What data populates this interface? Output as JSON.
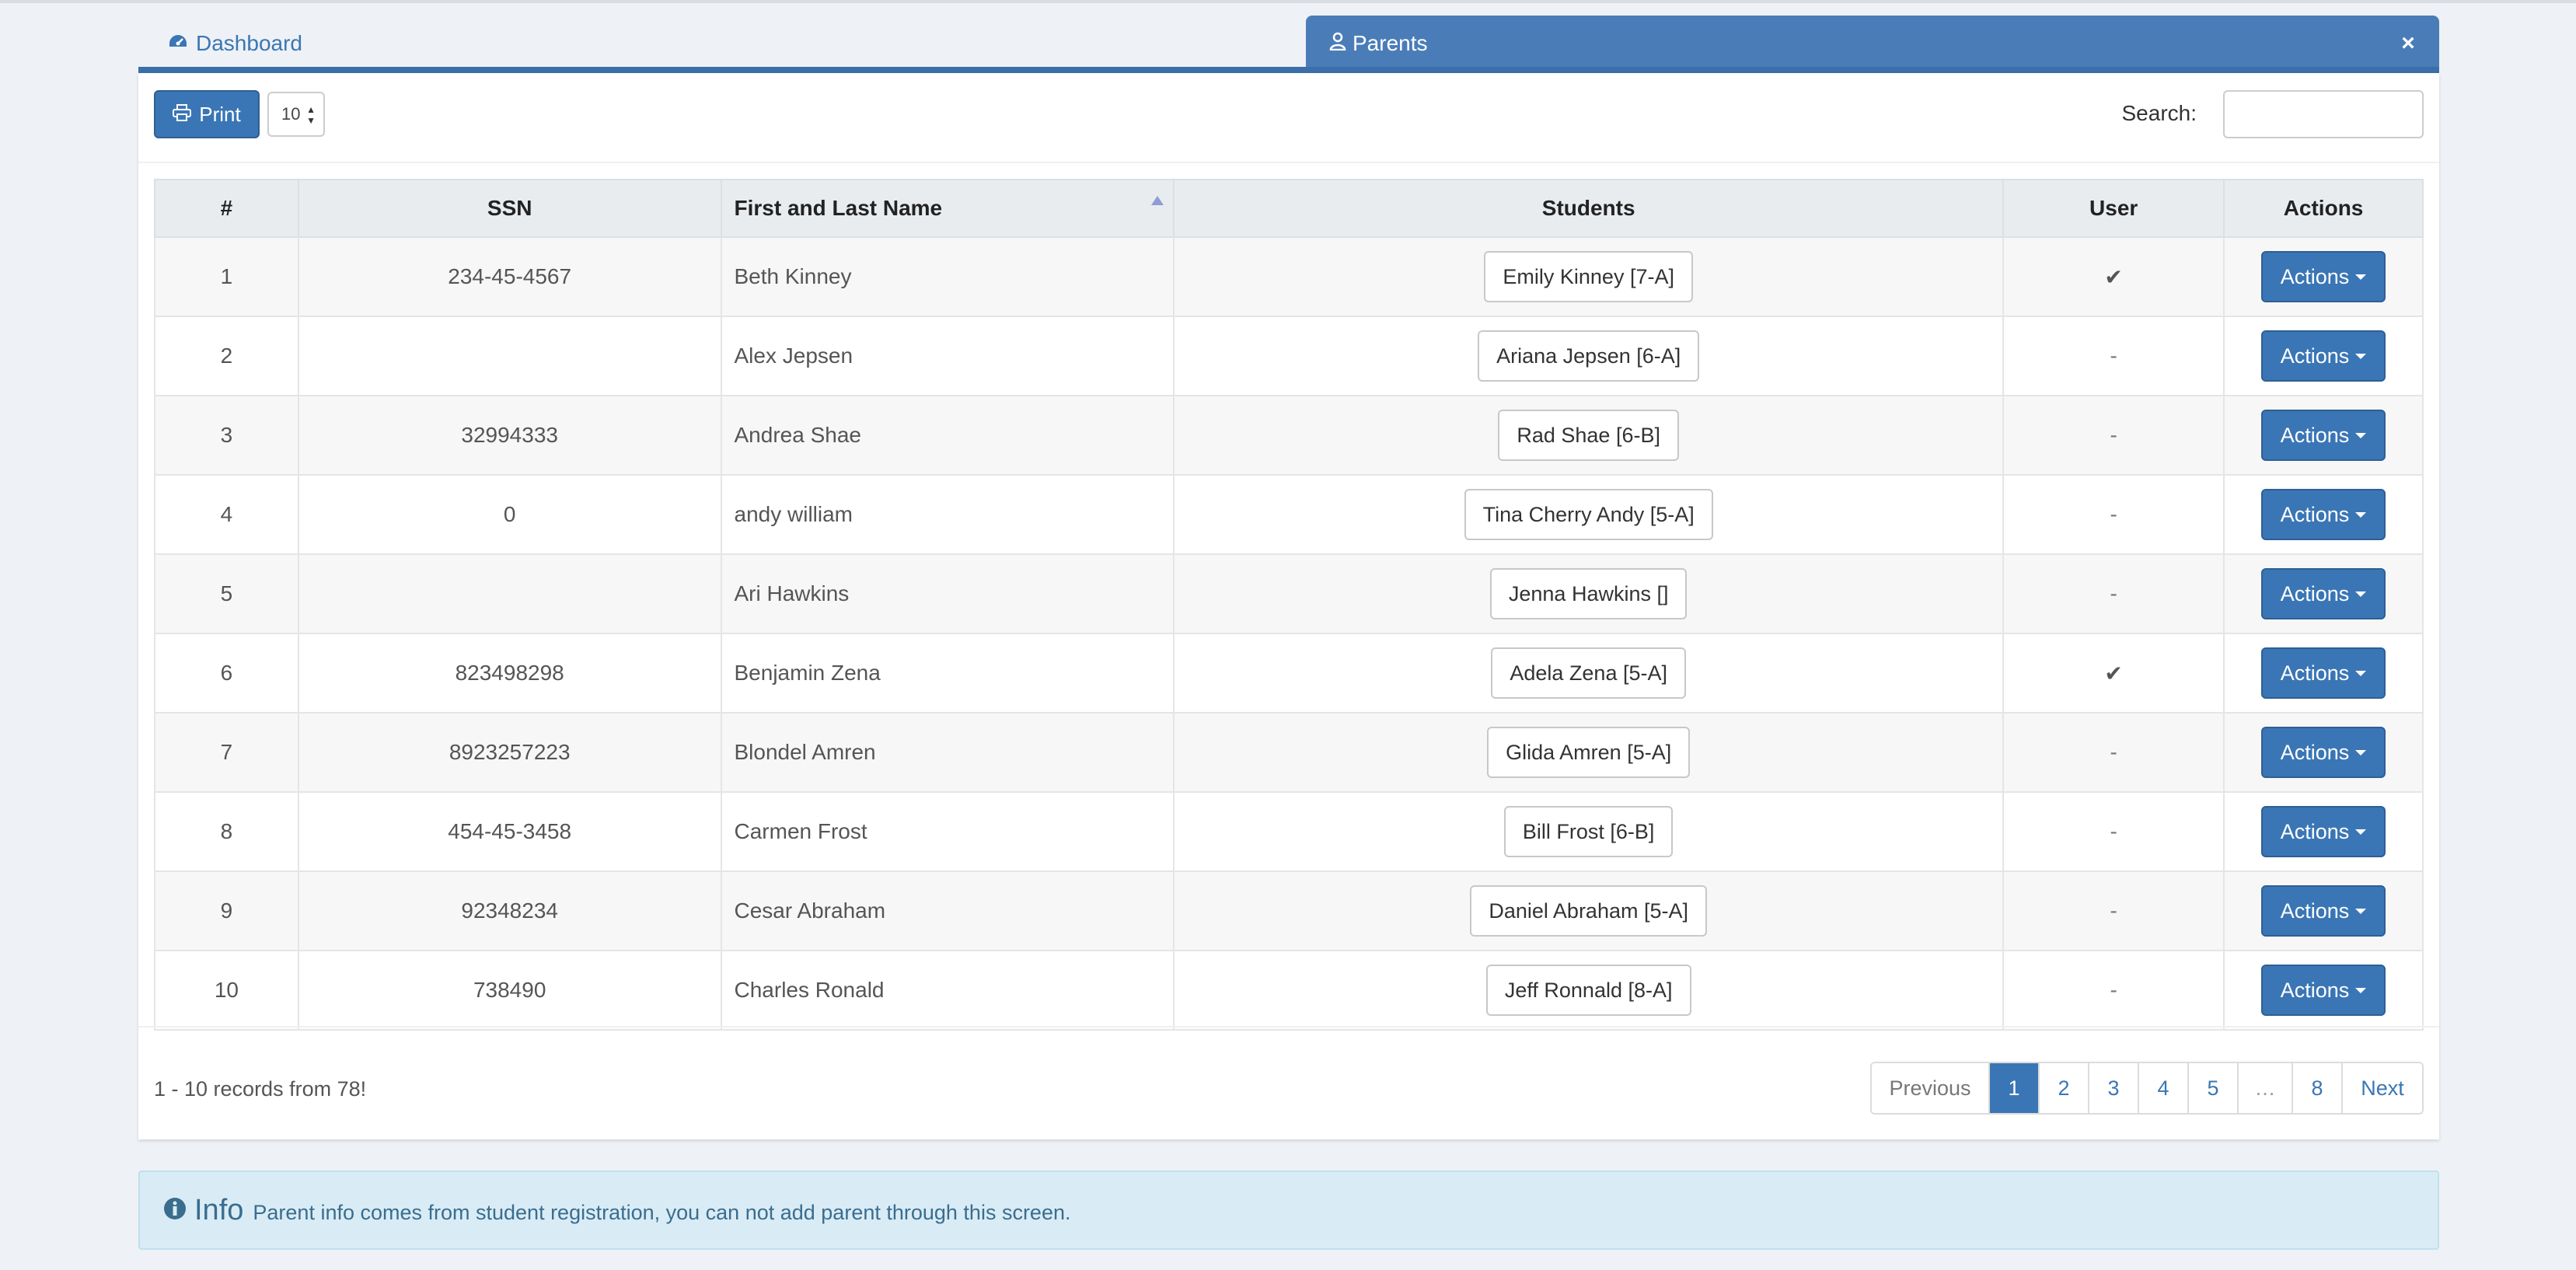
{
  "tabs": {
    "dashboard_label": "Dashboard",
    "parents_label": "Parents",
    "close_symbol": "×"
  },
  "toolbar": {
    "print_label": "Print",
    "page_size": "10",
    "search_label": "Search:",
    "search_value": ""
  },
  "table": {
    "headers": {
      "num": "#",
      "ssn": "SSN",
      "name": "First and Last Name",
      "students": "Students",
      "user": "User",
      "actions": "Actions"
    },
    "rows": [
      {
        "num": "1",
        "ssn": "234-45-4567",
        "name": "Beth Kinney",
        "student": "Emily Kinney [7-A]",
        "user": "✔",
        "action": "Actions"
      },
      {
        "num": "2",
        "ssn": "",
        "name": "Alex Jepsen",
        "student": "Ariana Jepsen [6-A]",
        "user": "-",
        "action": "Actions"
      },
      {
        "num": "3",
        "ssn": "32994333",
        "name": "Andrea Shae",
        "student": "Rad Shae [6-B]",
        "user": "-",
        "action": "Actions"
      },
      {
        "num": "4",
        "ssn": "0",
        "name": "andy william",
        "student": "Tina Cherry Andy [5-A]",
        "user": "-",
        "action": "Actions"
      },
      {
        "num": "5",
        "ssn": "",
        "name": "Ari Hawkins",
        "student": "Jenna Hawkins []",
        "user": "-",
        "action": "Actions"
      },
      {
        "num": "6",
        "ssn": "823498298",
        "name": "Benjamin Zena",
        "student": "Adela Zena [5-A]",
        "user": "✔",
        "action": "Actions"
      },
      {
        "num": "7",
        "ssn": "8923257223",
        "name": "Blondel Amren",
        "student": "Glida Amren [5-A]",
        "user": "-",
        "action": "Actions"
      },
      {
        "num": "8",
        "ssn": "454-45-3458",
        "name": "Carmen Frost",
        "student": "Bill Frost [6-B]",
        "user": "-",
        "action": "Actions"
      },
      {
        "num": "9",
        "ssn": "92348234",
        "name": "Cesar Abraham",
        "student": "Daniel Abraham [5-A]",
        "user": "-",
        "action": "Actions"
      },
      {
        "num": "10",
        "ssn": "738490",
        "name": "Charles Ronald",
        "student": "Jeff Ronnald [8-A]",
        "user": "-",
        "action": "Actions"
      }
    ]
  },
  "footer": {
    "records_text": "1 - 10 records from 78!",
    "pagination": {
      "previous": "Previous",
      "pages": [
        "1",
        "2",
        "3",
        "4",
        "5"
      ],
      "ellipsis": "…",
      "last": "8",
      "next": "Next",
      "active": "1"
    }
  },
  "info": {
    "title": "Info",
    "text": "Parent info comes from student registration, you can not add parent through this screen."
  },
  "colors": {
    "primary": "#3a76b5",
    "tab_active": "#4a7db8",
    "info_bg": "#d9ecf6"
  },
  "icons": [
    "dashboard-icon",
    "parents-icon",
    "close-icon",
    "print-icon",
    "checkmark-icon",
    "info-icon"
  ]
}
